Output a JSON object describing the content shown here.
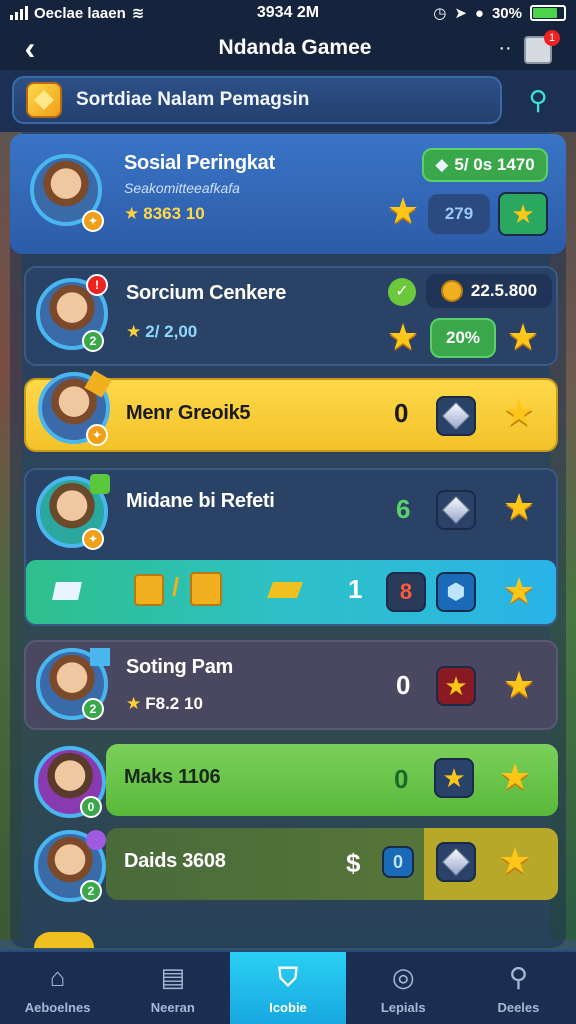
{
  "status": {
    "carrier": "Oeclae laaen",
    "time": "3934 2M",
    "battery": "30%"
  },
  "header": {
    "title": "Ndanda Gamee",
    "menu": "··",
    "notif_count": "1"
  },
  "search": {
    "placeholder": "Sortdiae Nalam Pemagsin"
  },
  "rows": [
    {
      "name": "Sosial Peringkat",
      "sub": "Seakomitteeafkafa",
      "score": "8363 10",
      "pill": "5/ 0s 1470",
      "box": "279"
    },
    {
      "name": "Sorcium Cenkere",
      "score": "2/ 2,00",
      "coins": "22.5.800",
      "pill": "20%"
    },
    {
      "name": "Menr Greoik5",
      "num": "0"
    },
    {
      "name": "Midane bi Refeti",
      "num": "6"
    },
    {
      "num": "1",
      "box": "8"
    },
    {
      "name": "Soting Pam",
      "score": "F8.2 10",
      "num": "0"
    },
    {
      "name": "Maks 1106",
      "num": "0"
    },
    {
      "name": "Daids 3608",
      "num": "$",
      "box": "0"
    }
  ],
  "nav": [
    {
      "label": "Aeboelnes",
      "icon": "home-icon"
    },
    {
      "label": "Neeran",
      "icon": "cards-icon"
    },
    {
      "label": "Icobie",
      "icon": "shield-icon",
      "active": true
    },
    {
      "label": "Lepials",
      "icon": "compass-icon"
    },
    {
      "label": "Deeles",
      "icon": "search-icon"
    }
  ],
  "colors": {
    "gold_row": "#f7cf3a",
    "teal_row": "#2ec0c8",
    "green_row": "#6bc74a",
    "accent": "#3ee0d0"
  }
}
